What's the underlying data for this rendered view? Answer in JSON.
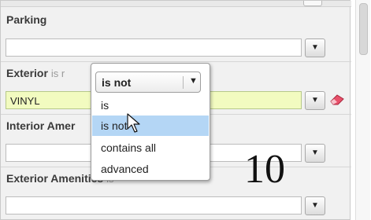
{
  "fields": [
    {
      "label": "Parking",
      "operator": "",
      "value": ""
    },
    {
      "label": "Exterior",
      "operator": "is r",
      "value": "VINYL"
    },
    {
      "label": "Interior Amer",
      "operator": "",
      "value": ""
    },
    {
      "label": "Exterior Amenities",
      "operator": "is",
      "value": ""
    }
  ],
  "icons": {
    "dropdown": "▼"
  },
  "popup": {
    "selected_value": "is not",
    "options": [
      "is",
      "is not",
      "contains all",
      "advanced"
    ]
  },
  "overlay_number": "10",
  "colors": {
    "highlight_field": "#f2fbc0",
    "selected_option": "#b4d6f5",
    "eraser": "#e8506a"
  }
}
